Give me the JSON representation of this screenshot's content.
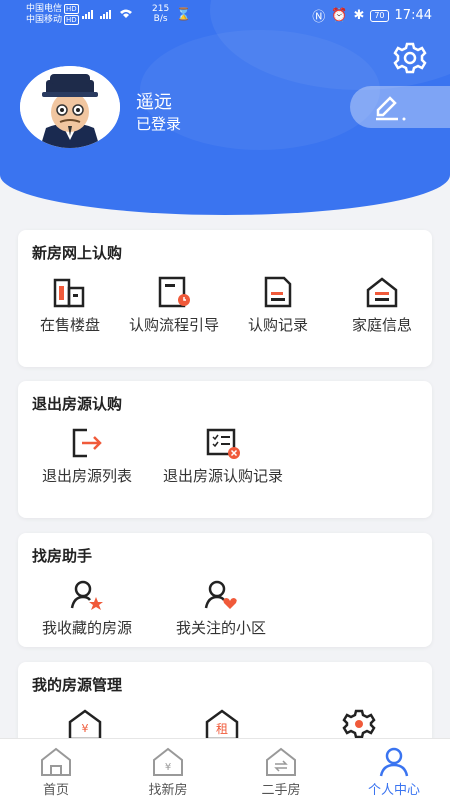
{
  "status": {
    "carrier1": "中国电信",
    "carrier2": "中国移动",
    "hd": "HD",
    "speed_value": "215",
    "speed_unit": "B/s",
    "battery": "70",
    "time": "17:44"
  },
  "profile": {
    "username": "遥远",
    "login_status": "已登录"
  },
  "sections": {
    "new_house": {
      "title": "新房网上认购",
      "items": [
        "在售楼盘",
        "认购流程引导",
        "认购记录",
        "家庭信息"
      ]
    },
    "exit": {
      "title": "退出房源认购",
      "items": [
        "退出房源列表",
        "退出房源认购记录"
      ]
    },
    "finder": {
      "title": "找房助手",
      "items": [
        "我收藏的房源",
        "我关注的小区"
      ]
    },
    "manage": {
      "title": "我的房源管理",
      "icon_text_sale": "¥",
      "icon_text_rent": "租"
    }
  },
  "tabs": [
    {
      "label": "首页",
      "icon": "home-icon"
    },
    {
      "label": "找新房",
      "icon": "new-house-icon"
    },
    {
      "label": "二手房",
      "icon": "second-hand-icon"
    },
    {
      "label": "个人中心",
      "icon": "person-icon",
      "active": true
    }
  ],
  "colors": {
    "primary": "#3a74f0",
    "accent": "#f05a3a"
  }
}
